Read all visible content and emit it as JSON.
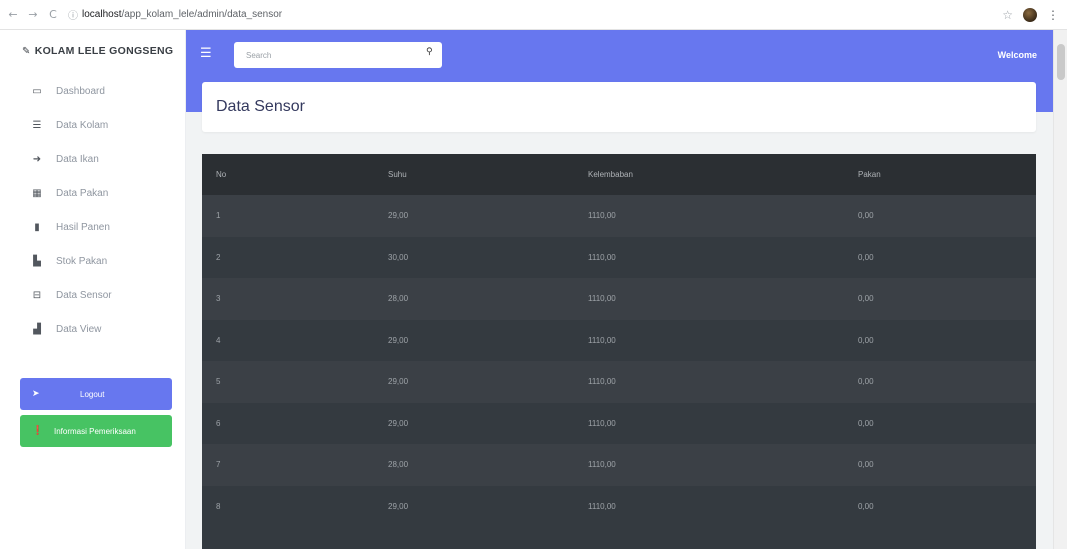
{
  "browser": {
    "url_host": "localhost",
    "url_path": "/app_kolam_lele/admin/data_sensor",
    "nav_back": "←",
    "nav_forward": "→",
    "nav_reload": "C"
  },
  "sidebar": {
    "brand": "KOLAM LELE GONGSENG",
    "items": [
      {
        "label": "Dashboard",
        "icon": "▭"
      },
      {
        "label": "Data Kolam",
        "icon": "☰"
      },
      {
        "label": "Data Ikan",
        "icon": "➜"
      },
      {
        "label": "Data Pakan",
        "icon": "▦"
      },
      {
        "label": "Hasil Panen",
        "icon": "▮"
      },
      {
        "label": "Stok Pakan",
        "icon": "▙"
      },
      {
        "label": "Data Sensor",
        "icon": "⊟"
      },
      {
        "label": "Data View",
        "icon": "▟"
      }
    ],
    "logout_label": "Logout",
    "help_label": "Informasi Pemeriksaan"
  },
  "header": {
    "search_placeholder": "Search",
    "welcome": "Welcome"
  },
  "page": {
    "title": "Data Sensor"
  },
  "table": {
    "columns": [
      "No",
      "Suhu",
      "Kelembaban",
      "Pakan"
    ],
    "rows": [
      [
        "1",
        "29,00",
        "1110,00",
        "0,00"
      ],
      [
        "2",
        "30,00",
        "1110,00",
        "0,00"
      ],
      [
        "3",
        "28,00",
        "1110,00",
        "0,00"
      ],
      [
        "4",
        "29,00",
        "1110,00",
        "0,00"
      ],
      [
        "5",
        "29,00",
        "1110,00",
        "0,00"
      ],
      [
        "6",
        "29,00",
        "1110,00",
        "0,00"
      ],
      [
        "7",
        "28,00",
        "1110,00",
        "0,00"
      ],
      [
        "8",
        "29,00",
        "1110,00",
        "0,00"
      ]
    ]
  },
  "colors": {
    "primary": "#6777ef",
    "success": "#47c363",
    "table_dark": "#343a40"
  }
}
